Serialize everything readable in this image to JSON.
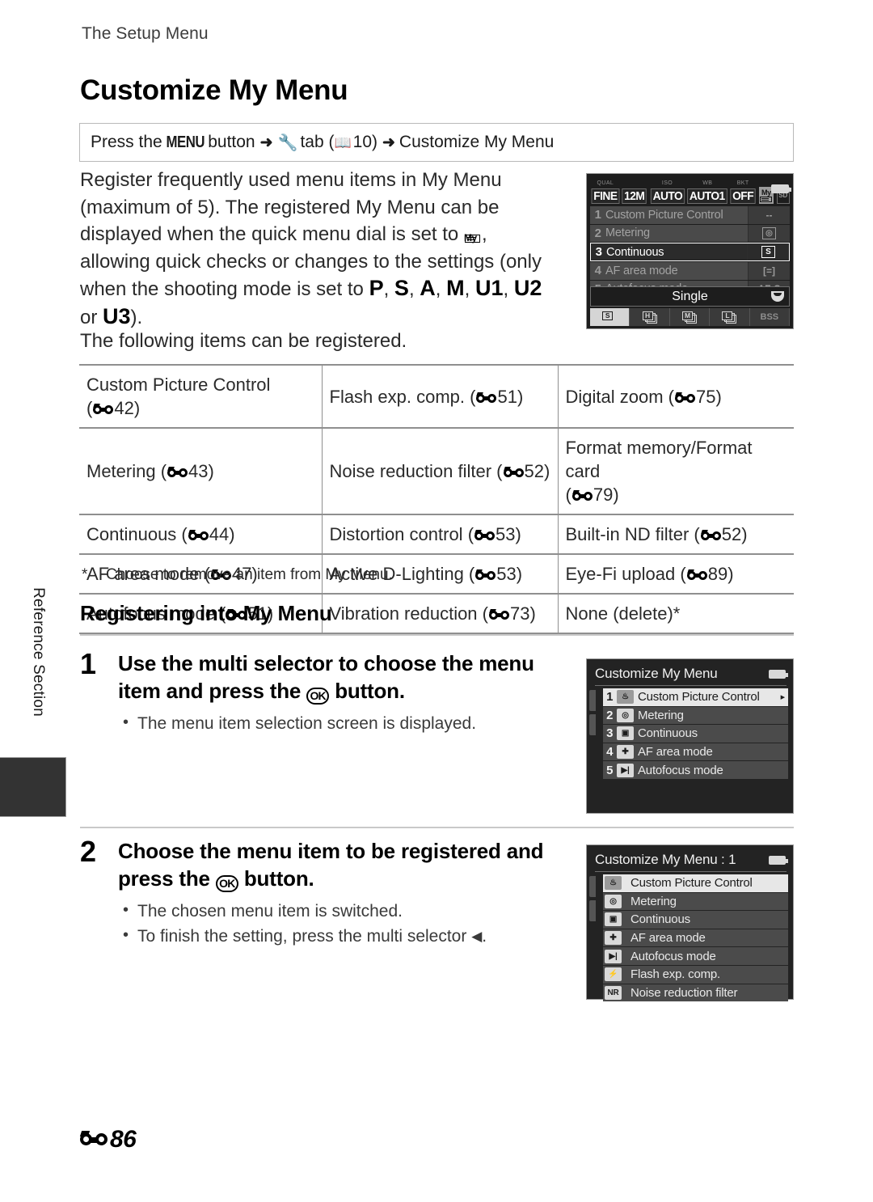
{
  "running_head": "The Setup Menu",
  "page_title": "Customize My Menu",
  "path_box": {
    "prefix": "Press the ",
    "menu_button": "MENU",
    "mid": " button",
    "arrow": "➜",
    "wrench_icon": "wrench-icon",
    "tab_word": "tab",
    "book_ref": "10",
    "destination": "Customize My Menu"
  },
  "intro": {
    "line1": "Register frequently used menu items in My Menu",
    "line2": "(maximum of 5). The registered My Menu can be",
    "line3a": "displayed when the quick menu dial is set to",
    "line3b": ",",
    "line4": "allowing quick checks or changes to the settings (only",
    "line5a": "when the shooting mode is set to",
    "modes": [
      "P",
      "S",
      "A",
      "M",
      "U1",
      "U2"
    ],
    "line6a": "or",
    "mode_last": "U3",
    "line6b": ").",
    "following": "The following items can be registered."
  },
  "items_table": {
    "rows": [
      [
        {
          "label": "Custom Picture Control",
          "ref": "42",
          "wrap": true
        },
        {
          "label": "Flash exp. comp.",
          "ref": "51"
        },
        {
          "label": "Digital zoom",
          "ref": "75"
        }
      ],
      [
        {
          "label": "Metering",
          "ref": "43"
        },
        {
          "label": "Noise reduction filter",
          "ref": "52"
        },
        {
          "label": "Format memory/Format card",
          "ref": "79",
          "wrap": true
        }
      ],
      [
        {
          "label": "Continuous",
          "ref": "44"
        },
        {
          "label": "Distortion control",
          "ref": "53"
        },
        {
          "label": "Built-in ND filter",
          "ref": "52"
        }
      ],
      [
        {
          "label": "AF area mode",
          "ref": "47"
        },
        {
          "label": "Active D-Lighting",
          "ref": "53"
        },
        {
          "label": "Eye-Fi upload",
          "ref": "89"
        }
      ],
      [
        {
          "label": "Autofocus mode",
          "ref": "51"
        },
        {
          "label": "Vibration reduction",
          "ref": "73"
        },
        {
          "label": "None (delete)*",
          "ref": ""
        }
      ]
    ],
    "note_marker": "*",
    "note": "Choose to remove an item from My Menu."
  },
  "section_heading": "Registering into My Menu",
  "steps": [
    {
      "number": "1",
      "head_a": "Use the multi selector to choose the menu",
      "head_b": "item and press the",
      "ok": "OK",
      "head_c": "button.",
      "bullets": [
        "The menu item selection screen is displayed."
      ]
    },
    {
      "number": "2",
      "head_a": "Choose the menu item to be registered and",
      "head_b": "press the",
      "ok": "OK",
      "head_c": "button.",
      "bullets": [
        "The chosen menu item is switched."
      ],
      "bullet2_a": "To finish the setting, press the multi selector",
      "bullet2_tri": "◀",
      "bullet2_b": "."
    }
  ],
  "screens": {
    "quick_menu": {
      "top_bar": [
        {
          "label": "QUAL",
          "value": "FINE"
        },
        {
          "label": "",
          "value": "12M"
        },
        {
          "label": "ISO",
          "value": "AUTO"
        },
        {
          "label": "WB",
          "value": "AUTO1"
        },
        {
          "label": "BKT",
          "value": "OFF"
        }
      ],
      "my_badge": "My",
      "sd_badge": "SD",
      "rows": [
        {
          "num": "1",
          "name": "Custom Picture Control",
          "value": "--",
          "selected": false
        },
        {
          "num": "2",
          "name": "Metering",
          "value": "metering-icon",
          "selected": false
        },
        {
          "num": "3",
          "name": "Continuous",
          "value": "S",
          "selected": true
        },
        {
          "num": "4",
          "name": "AF area mode",
          "value": "[=]",
          "selected": false
        },
        {
          "num": "5",
          "name": "Autofocus mode",
          "value": "AF-S",
          "selected": false
        }
      ],
      "current_value": "Single",
      "bottom_icons": [
        "S",
        "H",
        "M",
        "L",
        "BSS"
      ]
    },
    "customize_list": {
      "title": "Customize My Menu",
      "rows": [
        {
          "num": "1",
          "icon": "picture-control-icon",
          "label": "Custom Picture Control",
          "chevron": "▸"
        },
        {
          "num": "2",
          "icon": "metering-icon",
          "label": "Metering"
        },
        {
          "num": "3",
          "icon": "continuous-icon",
          "label": "Continuous"
        },
        {
          "num": "4",
          "icon": "af-area-icon",
          "label": "AF area mode"
        },
        {
          "num": "5",
          "icon": "autofocus-icon",
          "label": "Autofocus mode"
        }
      ]
    },
    "select_list": {
      "title": "Customize My Menu : 1",
      "rows": [
        {
          "icon": "picture-control-icon",
          "label": "Custom Picture Control"
        },
        {
          "icon": "metering-icon",
          "label": "Metering"
        },
        {
          "icon": "continuous-icon",
          "label": "Continuous"
        },
        {
          "icon": "af-area-icon",
          "label": "AF area mode"
        },
        {
          "icon": "autofocus-icon",
          "label": "Autofocus mode"
        },
        {
          "icon": "flash-comp-icon",
          "label": "Flash exp. comp."
        },
        {
          "icon": "noise-reduction-icon",
          "label": "Noise reduction filter"
        }
      ]
    }
  },
  "side_tab": "Reference Section",
  "footer": {
    "page": "86"
  }
}
